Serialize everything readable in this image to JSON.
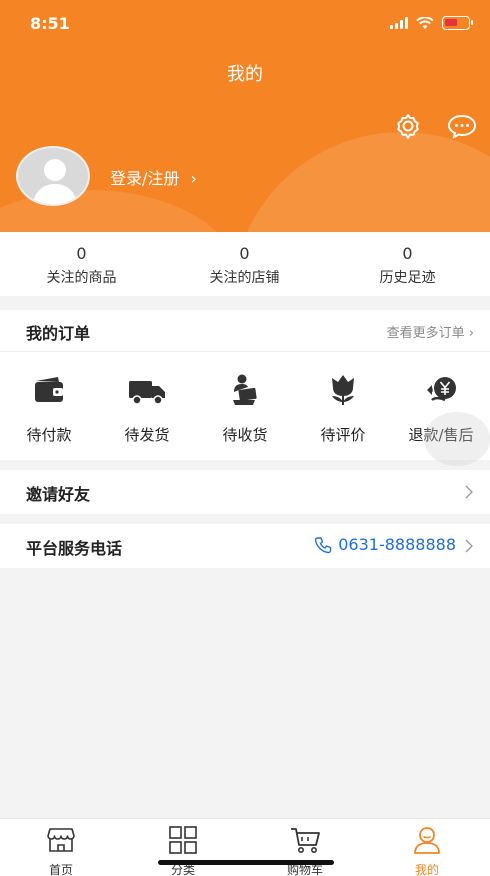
{
  "status": {
    "time": "8:51"
  },
  "header": {
    "title": "我的",
    "login_label": "登录/注册"
  },
  "stats": [
    {
      "num": "0",
      "label": "关注的商品"
    },
    {
      "num": "0",
      "label": "关注的店铺"
    },
    {
      "num": "0",
      "label": "历史足迹"
    }
  ],
  "orders": {
    "title": "我的订单",
    "more": "查看更多订单",
    "items": [
      {
        "label": "待付款",
        "icon": "wallet-icon"
      },
      {
        "label": "待发货",
        "icon": "truck-icon"
      },
      {
        "label": "待收货",
        "icon": "receive-package-icon"
      },
      {
        "label": "待评价",
        "icon": "flower-icon"
      },
      {
        "label": "退款/售后",
        "icon": "refund-yen-icon"
      }
    ]
  },
  "invite": {
    "label": "邀请好友"
  },
  "service": {
    "label": "平台服务电话",
    "phone": "0631-8888888"
  },
  "tabbar": [
    {
      "label": "首页",
      "icon": "store-icon"
    },
    {
      "label": "分类",
      "icon": "grid-icon"
    },
    {
      "label": "购物车",
      "icon": "cart-icon"
    },
    {
      "label": "我的",
      "icon": "user-icon",
      "active": true
    }
  ],
  "colors": {
    "brand": "#f58425",
    "link": "#1f6fd8"
  }
}
